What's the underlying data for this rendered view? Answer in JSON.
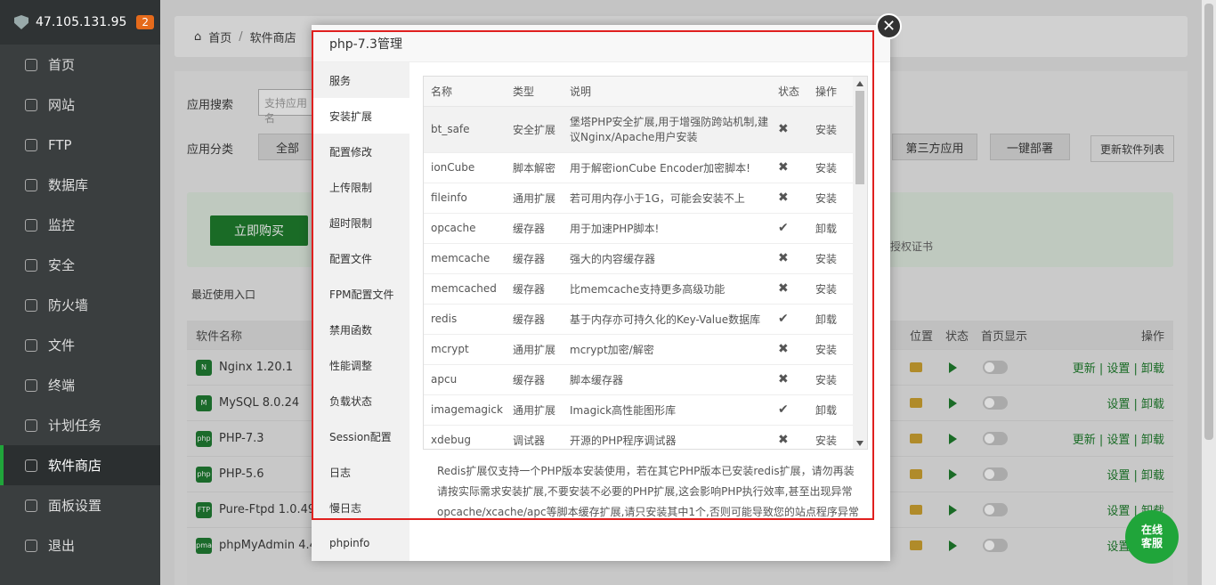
{
  "server": {
    "ip": "47.105.131.95",
    "badge": "2"
  },
  "nav": [
    {
      "label": "首页",
      "icon": "home-icon"
    },
    {
      "label": "网站",
      "icon": "globe-icon"
    },
    {
      "label": "FTP",
      "icon": "ftp-icon"
    },
    {
      "label": "数据库",
      "icon": "database-icon"
    },
    {
      "label": "监控",
      "icon": "monitor-icon"
    },
    {
      "label": "安全",
      "icon": "shield-icon"
    },
    {
      "label": "防火墙",
      "icon": "firewall-icon"
    },
    {
      "label": "文件",
      "icon": "folder-icon"
    },
    {
      "label": "终端",
      "icon": "terminal-icon"
    },
    {
      "label": "计划任务",
      "icon": "calendar-icon"
    },
    {
      "label": "软件商店",
      "icon": "grid-icon",
      "active": true
    },
    {
      "label": "面板设置",
      "icon": "settings-icon"
    },
    {
      "label": "退出",
      "icon": "logout-icon"
    }
  ],
  "breadcrumb": {
    "home": "首页",
    "sep": "/",
    "current": "软件商店"
  },
  "store": {
    "search_label": "应用搜索",
    "search_placeholder": "支持应用名",
    "category_label": "应用分类",
    "cat_all": "全部",
    "cat_third": "第三方应用",
    "cat_deploy": "一键部署",
    "update_list": "更新软件列表",
    "buy": "立即购买",
    "cert_text": "授权证书",
    "recent": "最近使用入口",
    "head_name": "软件名称",
    "head_location": "位置",
    "head_status": "状态",
    "head_homepage": "首页显示",
    "head_ops": "操作",
    "rows": [
      {
        "name": "Nginx 1.20.1",
        "icon": "N",
        "ops": "更新 | 设置 | 卸载"
      },
      {
        "name": "MySQL 8.0.24",
        "icon": "M",
        "ops": "设置 | 卸载"
      },
      {
        "name": "PHP-7.3",
        "icon": "php",
        "ops": "更新 | 设置 | 卸载"
      },
      {
        "name": "PHP-5.6",
        "icon": "php",
        "ops": "设置 | 卸载"
      },
      {
        "name": "Pure-Ftpd 1.0.49",
        "icon": "FTP",
        "ops": "设置 | 卸载"
      },
      {
        "name": "phpMyAdmin 4.4",
        "icon": "pma",
        "ops": "设置 | 卸载"
      }
    ]
  },
  "modal": {
    "title": "php-7.3管理",
    "menu": [
      "服务",
      "安装扩展",
      "配置修改",
      "上传限制",
      "超时限制",
      "配置文件",
      "FPM配置文件",
      "禁用函数",
      "性能调整",
      "负载状态",
      "Session配置",
      "日志",
      "慢日志",
      "phpinfo"
    ],
    "active_menu": "安装扩展",
    "headers": {
      "name": "名称",
      "type": "类型",
      "desc": "说明",
      "status": "状态",
      "op": "操作"
    },
    "extensions": [
      {
        "name": "bt_safe",
        "type": "安全扩展",
        "desc": "堡塔PHP安全扩展,用于增强防跨站机制,建议Nginx/Apache用户安装",
        "status": "✖",
        "op": "安装"
      },
      {
        "name": "ionCube",
        "type": "脚本解密",
        "desc": "用于解密ionCube Encoder加密脚本!",
        "status": "✖",
        "op": "安装"
      },
      {
        "name": "fileinfo",
        "type": "通用扩展",
        "desc": "若可用内存小于1G，可能会安装不上",
        "status": "✖",
        "op": "安装"
      },
      {
        "name": "opcache",
        "type": "缓存器",
        "desc": "用于加速PHP脚本!",
        "status": "✔",
        "op": "卸载"
      },
      {
        "name": "memcache",
        "type": "缓存器",
        "desc": "强大的内容缓存器",
        "status": "✖",
        "op": "安装"
      },
      {
        "name": "memcached",
        "type": "缓存器",
        "desc": "比memcache支持更多高级功能",
        "status": "✖",
        "op": "安装"
      },
      {
        "name": "redis",
        "type": "缓存器",
        "desc": "基于内存亦可持久化的Key-Value数据库",
        "status": "✔",
        "op": "卸载"
      },
      {
        "name": "mcrypt",
        "type": "通用扩展",
        "desc": "mcrypt加密/解密",
        "status": "✖",
        "op": "安装"
      },
      {
        "name": "apcu",
        "type": "缓存器",
        "desc": "脚本缓存器",
        "status": "✖",
        "op": "安装"
      },
      {
        "name": "imagemagick",
        "type": "通用扩展",
        "desc": "Imagick高性能图形库",
        "status": "✔",
        "op": "卸载"
      },
      {
        "name": "xdebug",
        "type": "调试器",
        "desc": "开源的PHP程序调试器",
        "status": "✖",
        "op": "安装"
      }
    ],
    "notes": [
      "Redis扩展仅支持一个PHP版本安装使用，若在其它PHP版本已安装redis扩展，请勿再装",
      "请按实际需求安装扩展,不要安装不必要的PHP扩展,这会影响PHP执行效率,甚至出现异常",
      "opcache/xcache/apc等脚本缓存扩展,请只安装其中1个,否则可能导致您的站点程序异常"
    ]
  },
  "chat": {
    "line1": "在线",
    "line2": "客服"
  }
}
